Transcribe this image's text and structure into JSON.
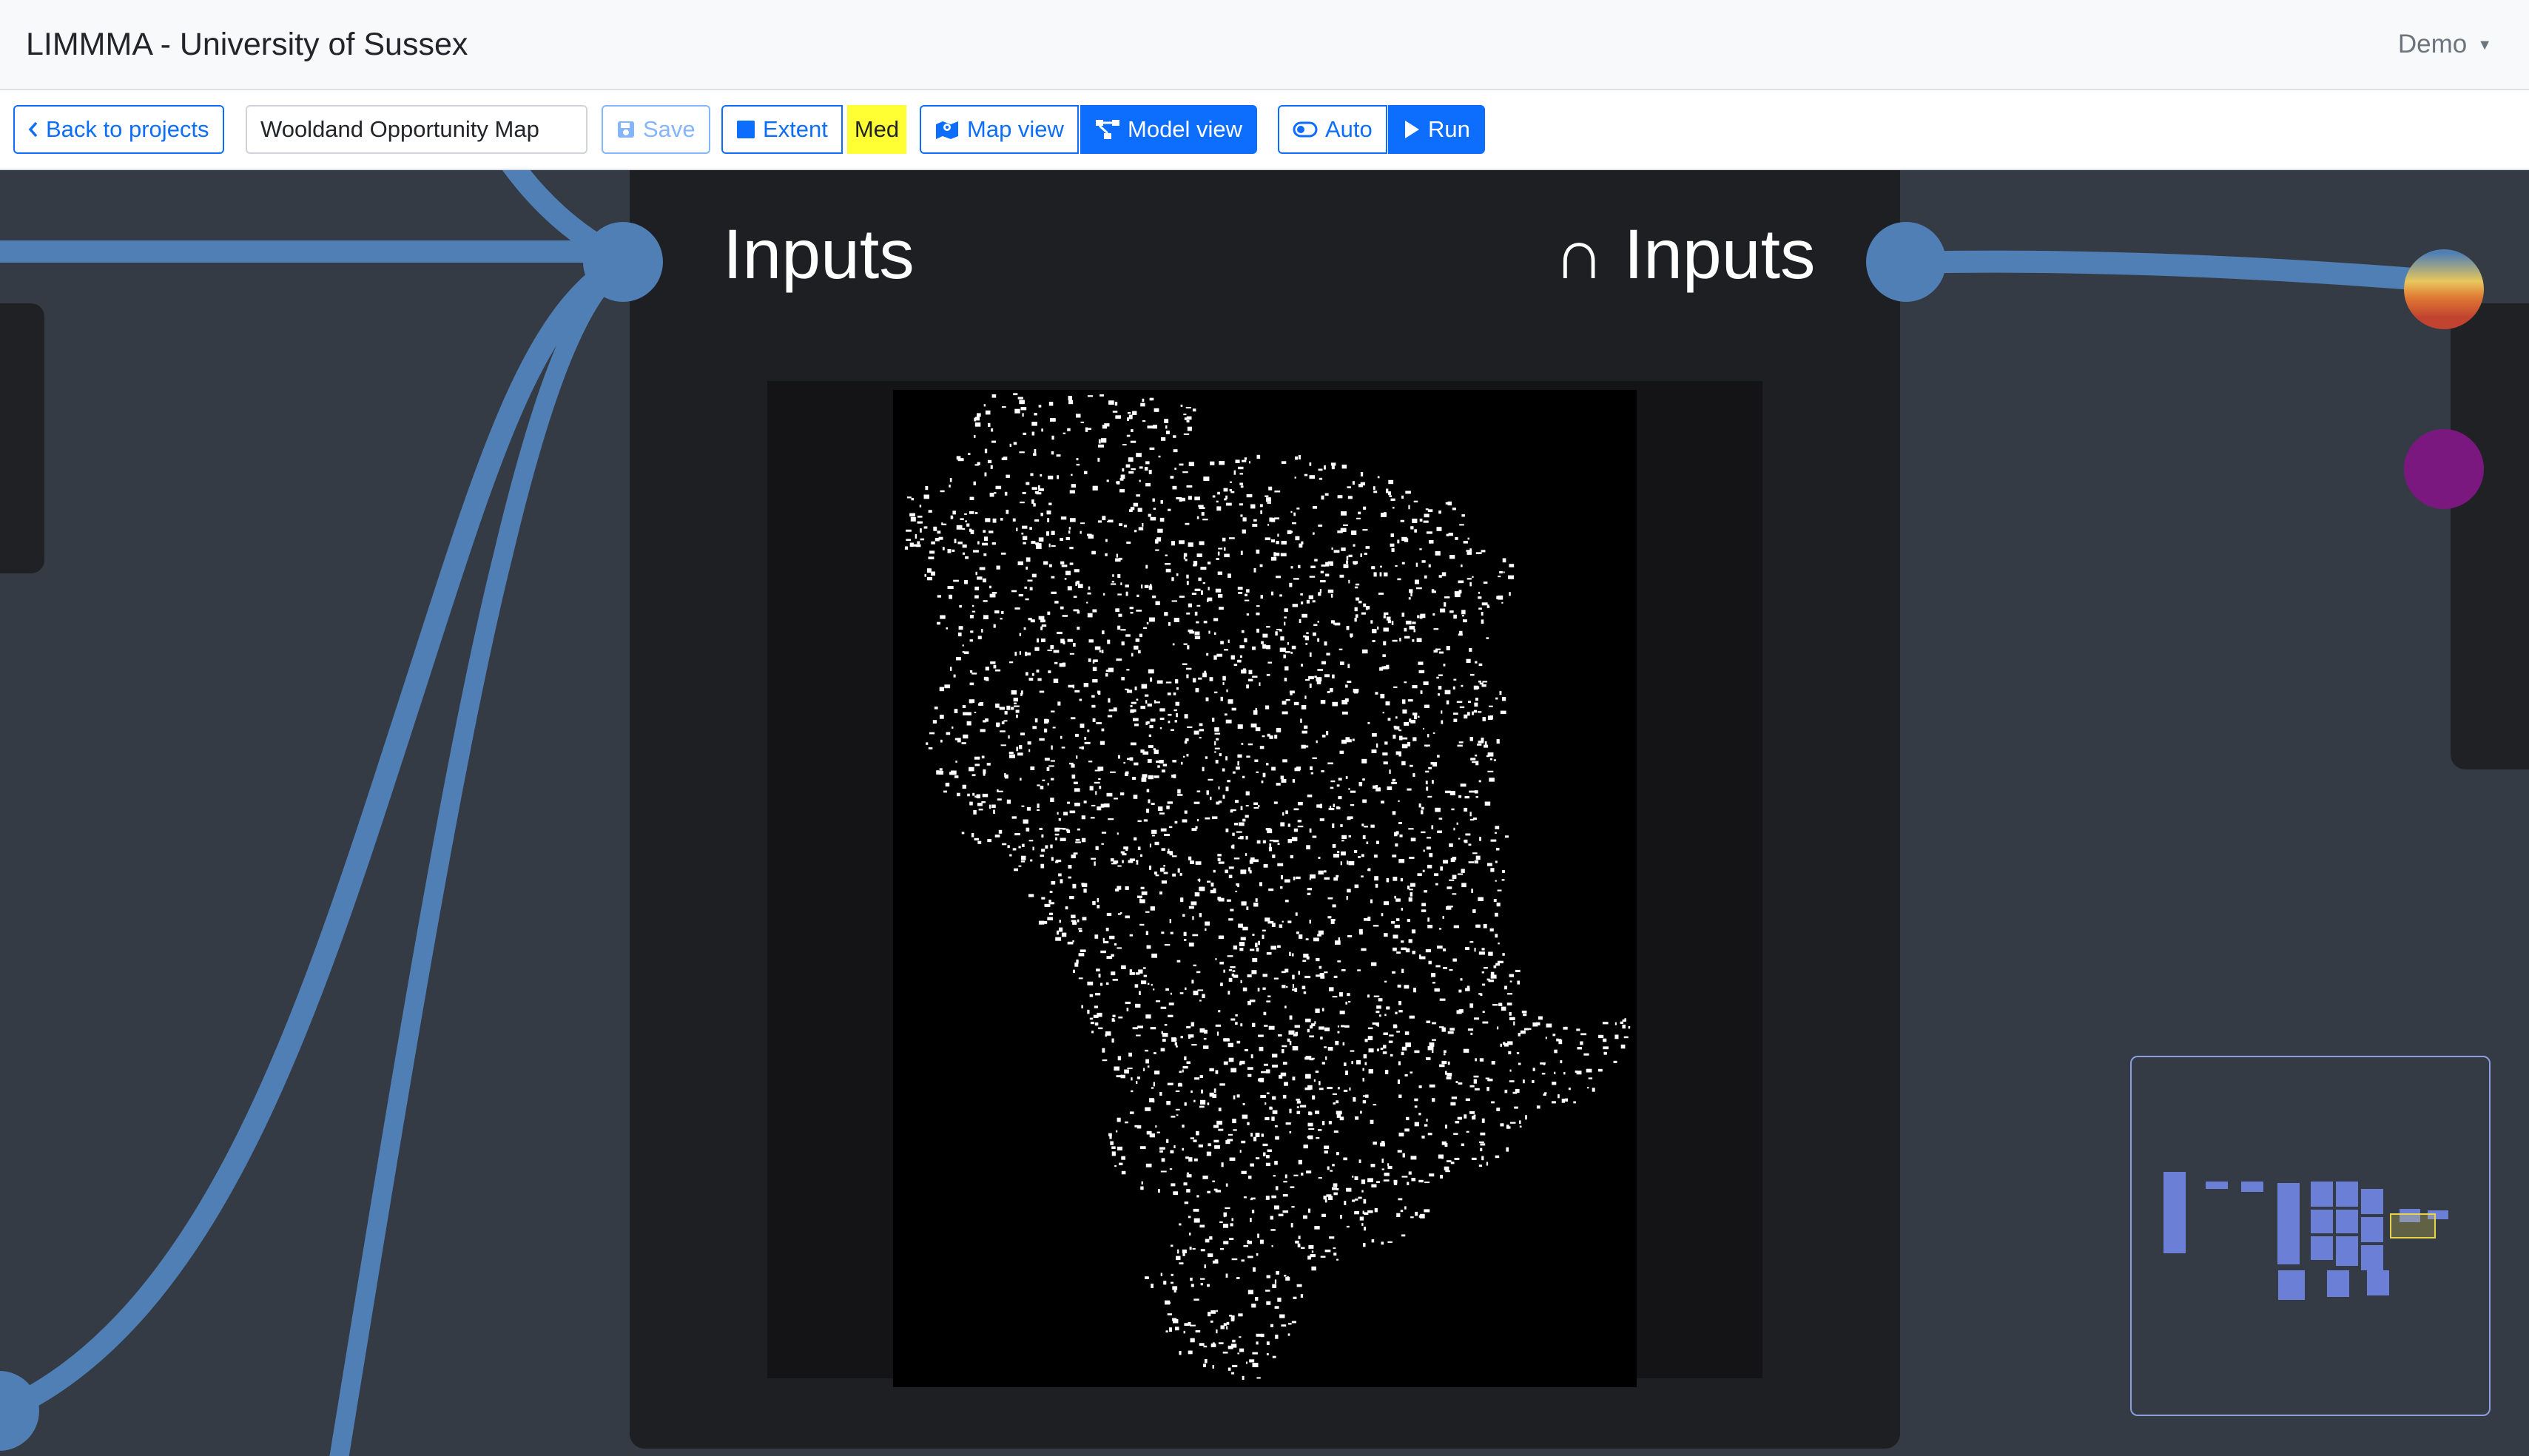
{
  "app": {
    "title": "LIMMMA - University of Sussex"
  },
  "user_menu": {
    "label": "Demo"
  },
  "toolbar": {
    "back_label": "Back to projects",
    "project_name": "Wooldand Opportunity Map",
    "save_label": "Save",
    "extent_label": "Extent",
    "quality_label": "Med",
    "map_view_label": "Map view",
    "model_view_label": "Model view",
    "auto_label": "Auto",
    "run_label": "Run"
  },
  "node": {
    "title_left": "Inputs",
    "title_right": "∩ Inputs"
  },
  "colors": {
    "wire": "#4f7fb5",
    "accent": "#0d6efd",
    "quality_badge": "#ffff33",
    "port_purple": "#7b1880",
    "minimap_block": "#6b7fd7"
  },
  "icons": {
    "back": "chevron-left-icon",
    "save": "floppy-disk-icon",
    "extent": "square-icon",
    "map_view": "map-icon",
    "model_view": "diagram-icon",
    "auto": "toggle-icon",
    "run": "play-icon"
  }
}
